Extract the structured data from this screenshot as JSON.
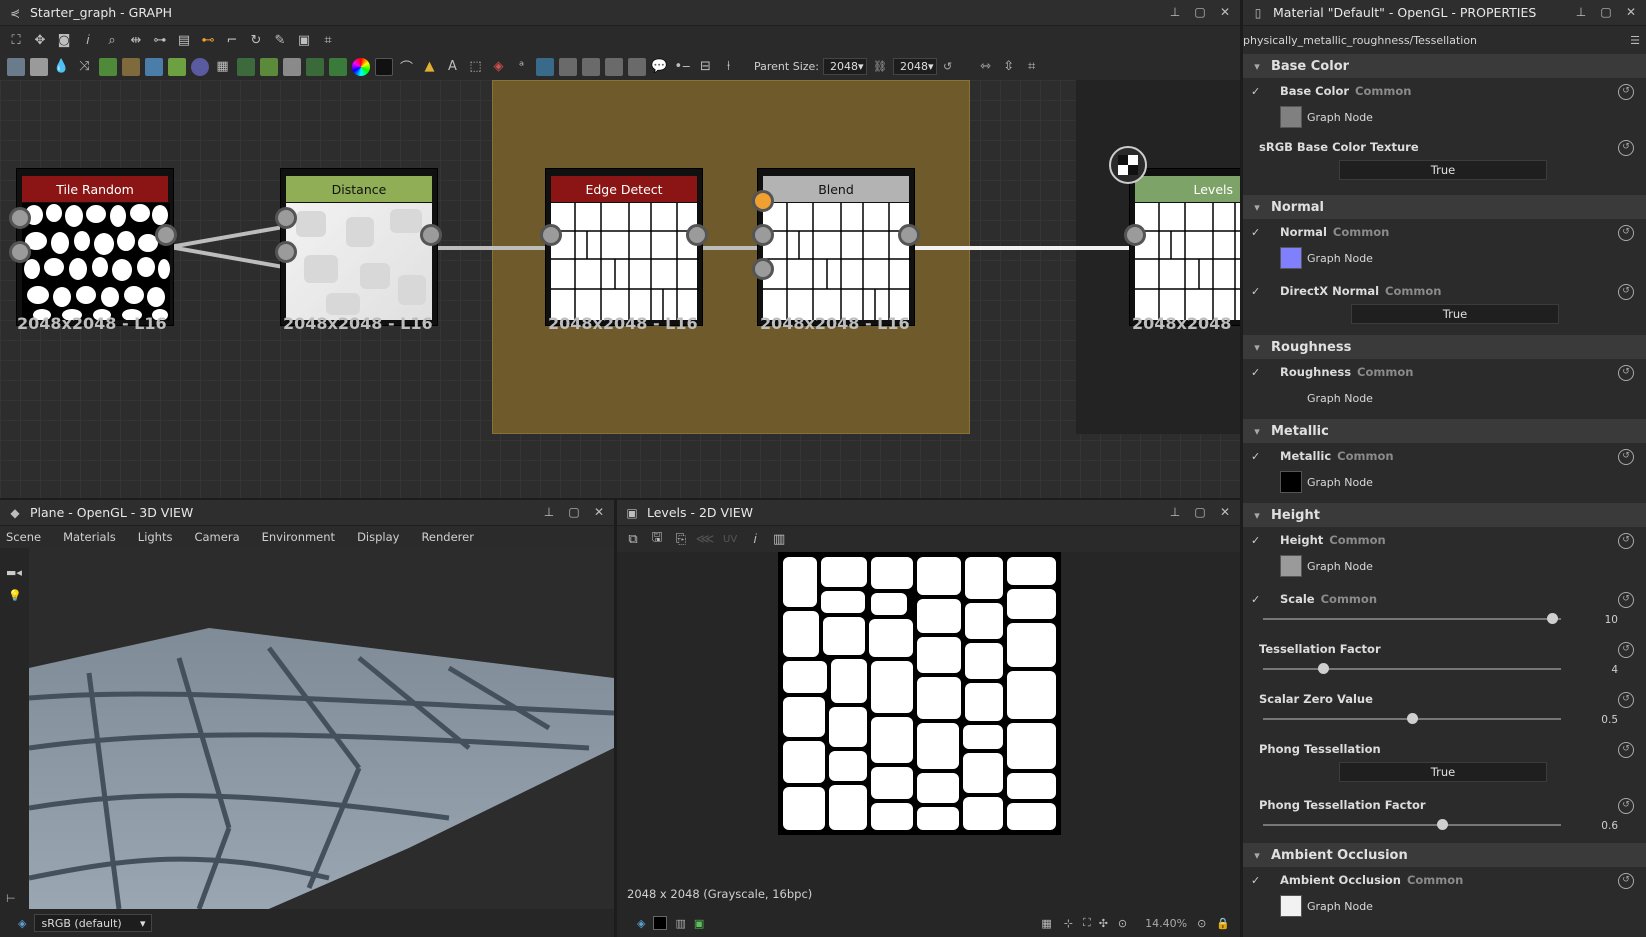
{
  "graph": {
    "title": "Starter_graph - GRAPH",
    "parent_size_label": "Parent Size:",
    "parent_size_w": "2048",
    "parent_size_h": "2048"
  },
  "nodes": [
    {
      "title": "Tile Random",
      "res": "2048x2048 - L16",
      "color": "#8b1414"
    },
    {
      "title": "Distance",
      "res": "2048x2048 - L16",
      "color": "#8fae55"
    },
    {
      "title": "Edge Detect",
      "res": "2048x2048 - L16",
      "color": "#8b1414"
    },
    {
      "title": "Blend",
      "res": "2048x2048 - L16",
      "color": "#b3b3b3"
    },
    {
      "title": "Levels",
      "res": "2048x2048",
      "color": "#7ea368"
    }
  ],
  "view3d": {
    "title": "Plane - OpenGL - 3D VIEW",
    "menu": [
      "Scene",
      "Materials",
      "Lights",
      "Camera",
      "Environment",
      "Display",
      "Renderer"
    ],
    "colorspace": "sRGB (default)"
  },
  "view2d": {
    "title": "Levels - 2D VIEW",
    "uv": "UV",
    "info": "2048 x 2048 (Grayscale, 16bpc)",
    "zoom": "14.40%"
  },
  "props": {
    "title": "Material \"Default\" - OpenGL - PROPERTIES",
    "path": "physically_metallic_roughness/Tessellation",
    "graph_node": "Graph Node",
    "common": "Common",
    "true": "True",
    "sections": {
      "base_color": "Base Color",
      "normal": "Normal",
      "roughness": "Roughness",
      "metallic": "Metallic",
      "height": "Height",
      "ao": "Ambient Occlusion"
    },
    "params": {
      "base_color": "Base Color",
      "srgb": "sRGB Base Color Texture",
      "normal": "Normal",
      "directx": "DirectX Normal",
      "roughness": "Roughness",
      "metallic": "Metallic",
      "height": "Height",
      "scale": "Scale",
      "scale_val": "10",
      "tess": "Tessellation Factor",
      "tess_val": "4",
      "szv": "Scalar Zero Value",
      "szv_val": "0.5",
      "phong": "Phong Tessellation",
      "ptf": "Phong Tessellation Factor",
      "ptf_val": "0.6",
      "ao": "Ambient Occlusion"
    },
    "levels": {
      "scale": 0.97,
      "tess": 0.2,
      "szv": 0.5,
      "ptf": 0.6
    }
  },
  "colors": {
    "base_swatch": "#808080",
    "normal_swatch": "#8080ff",
    "metal_swatch": "#000000",
    "frame": "#6e5a2a",
    "accent": "#f0a030"
  }
}
